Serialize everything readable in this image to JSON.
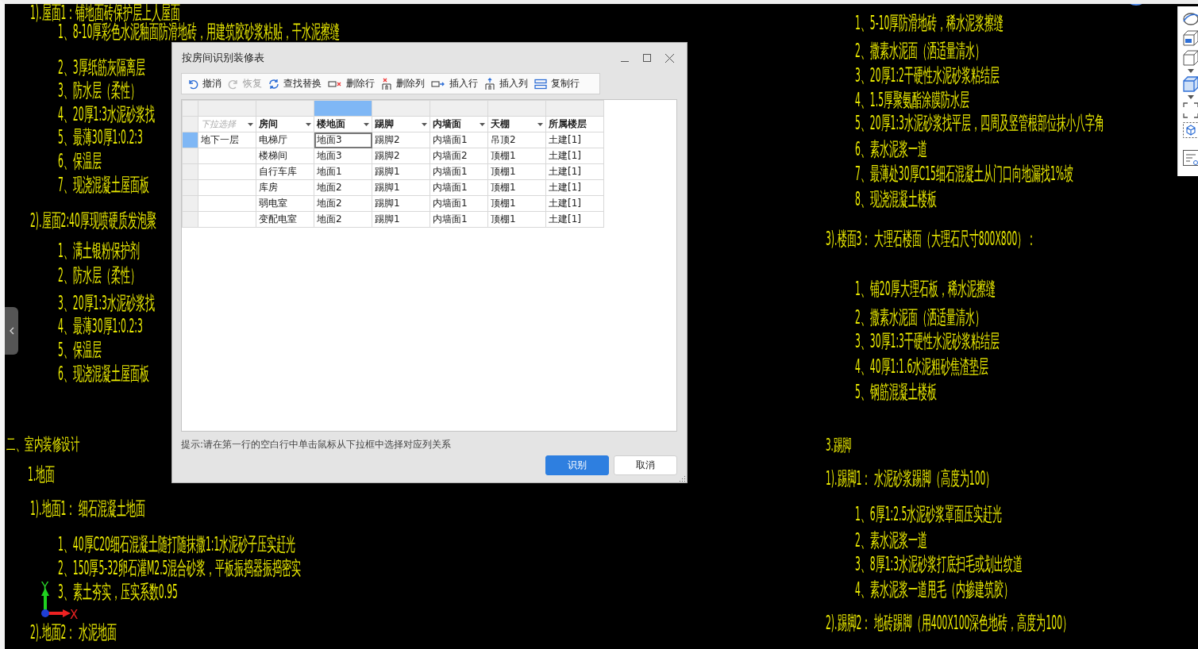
{
  "canvas": {
    "left_lines": [
      {
        "kind": "sub",
        "text": "1).屋面1：铺地面砖保护层上人屋面"
      },
      {
        "kind": "item",
        "text": "1、8-10厚彩色水泥釉面防滑地砖，用建筑胶砂浆粘贴，干水泥擦缝"
      },
      {
        "kind": "item",
        "text": "2、3厚纸筋灰隔离层"
      },
      {
        "kind": "item",
        "text": "3、防水层（柔性）"
      },
      {
        "kind": "item",
        "text": "4、20厚1:3水泥砂浆找"
      },
      {
        "kind": "item",
        "text": "5、最薄30厚1:0.2:3"
      },
      {
        "kind": "item",
        "text": "6、保温层"
      },
      {
        "kind": "item",
        "text": "7、现浇混凝土屋面板"
      },
      {
        "kind": "sub",
        "text": "2).屋面2:40厚现喷硬质发泡聚"
      },
      {
        "kind": "item",
        "text": "1、满土银粉保护剂"
      },
      {
        "kind": "item",
        "text": "2、防水层（柔性）"
      },
      {
        "kind": "item",
        "text": "3、20厚1:3水泥砂浆找"
      },
      {
        "kind": "item",
        "text": "4、最薄30厚1:0.2:3"
      },
      {
        "kind": "item",
        "text": "5、保温层"
      },
      {
        "kind": "item",
        "text": "6、现浇混凝土屋面板"
      },
      {
        "kind": "section",
        "text": "二、室内装修设计"
      },
      {
        "kind": "group",
        "text": "1.地面"
      },
      {
        "kind": "sub",
        "text": "1).地面1：  细石混凝土地面"
      },
      {
        "kind": "item",
        "text": "1、40厚C20细石混凝土随打随抹撒1:1水泥砂子压实赶光"
      },
      {
        "kind": "item",
        "text": "2、150厚5-32卵石灌M2.5混合砂浆，平板振捣器振捣密实"
      },
      {
        "kind": "item",
        "text": "3、素土夯实，压实系数0.95"
      },
      {
        "kind": "sub",
        "text": "2).地面2：  水泥地面"
      }
    ],
    "right_lines": [
      {
        "kind": "item",
        "text": "1、5-10厚防滑地砖，稀水泥浆擦缝"
      },
      {
        "kind": "item",
        "text": "2、撒素水泥面（洒适量清水）"
      },
      {
        "kind": "item",
        "text": "3、20厚1:2干硬性水泥砂浆粘结层"
      },
      {
        "kind": "item",
        "text": "4、1.5厚聚氨酯涂膜防水层"
      },
      {
        "kind": "item",
        "text": "5、20厚1:3水泥砂浆找平层，四周及竖管根部位抹小八字角"
      },
      {
        "kind": "item",
        "text": "6、素水泥浆一道"
      },
      {
        "kind": "item",
        "text": "7、最薄处30厚C15细石混凝土从门口向地漏找1%坡"
      },
      {
        "kind": "item",
        "text": "8、现浇混凝土楼板"
      },
      {
        "kind": "sub",
        "text": "3).楼面3：  大理石楼面（大理石尺寸800X800）："
      },
      {
        "kind": "item",
        "text": "1、铺20厚大理石板，稀水泥擦缝"
      },
      {
        "kind": "item",
        "text": "2、撒素水泥面（洒适量清水）"
      },
      {
        "kind": "item",
        "text": "3、30厚1:3干硬性水泥砂浆粘结层"
      },
      {
        "kind": "item",
        "text": "4、40厚1:1.6水泥粗砂焦渣垫层"
      },
      {
        "kind": "item",
        "text": "5、钢筋混凝土楼板"
      },
      {
        "kind": "section",
        "text": "3.踢脚"
      },
      {
        "kind": "sub",
        "text": "1).踢脚1：  水泥砂浆踢脚（高度为100）"
      },
      {
        "kind": "item",
        "text": "1、6厚1:2.5水泥砂浆罩面压实赶光"
      },
      {
        "kind": "item",
        "text": "2、素水泥浆一道"
      },
      {
        "kind": "item",
        "text": "3、8厚1:3水泥砂浆打底扫毛或划出纹道"
      },
      {
        "kind": "item",
        "text": "4、素水泥浆一道甩毛（内掺建筑胶）"
      },
      {
        "kind": "sub",
        "text": "2).踢脚2：  地砖踢脚（用400X100深色地砖，高度为100）"
      }
    ],
    "ucs": {
      "y_label": "Y",
      "x_label": "X"
    }
  },
  "dialog": {
    "title": "按房间识别装修表",
    "toolbar": [
      {
        "label": "撤消",
        "disabled": false
      },
      {
        "label": "恢复",
        "disabled": true
      },
      {
        "label": "查找替换",
        "disabled": false
      },
      {
        "label": "删除行",
        "disabled": false
      },
      {
        "label": "删除列",
        "disabled": false
      },
      {
        "label": "插入行",
        "disabled": false
      },
      {
        "label": "插入列",
        "disabled": false
      },
      {
        "label": "复制行",
        "disabled": false
      }
    ],
    "columns": [
      {
        "placeholder": "下拉选择",
        "dropdown": true,
        "selected": false
      },
      {
        "label": "房间",
        "dropdown": true,
        "selected": false
      },
      {
        "label": "楼地面",
        "dropdown": true,
        "selected": true
      },
      {
        "label": "踢脚",
        "dropdown": true,
        "selected": false
      },
      {
        "label": "内墙面",
        "dropdown": true,
        "selected": false
      },
      {
        "label": "天棚",
        "dropdown": true,
        "selected": false
      },
      {
        "label": "所属楼层",
        "dropdown": false,
        "selected": false
      }
    ],
    "rows": [
      {
        "selected": true,
        "cells": [
          "地下一层",
          "电梯厅",
          "地面3",
          "踢脚2",
          "内墙面1",
          "吊顶2",
          "土建[1]"
        ]
      },
      {
        "selected": false,
        "cells": [
          null,
          "楼梯间",
          "地面3",
          "踢脚2",
          "内墙面2",
          "顶棚1",
          "土建[1]"
        ]
      },
      {
        "selected": false,
        "cells": [
          null,
          "自行车库",
          "地面1",
          "踢脚1",
          "内墙面1",
          "顶棚1",
          "土建[1]"
        ]
      },
      {
        "selected": false,
        "cells": [
          null,
          "库房",
          "地面2",
          "踢脚1",
          "内墙面1",
          "顶棚1",
          "土建[1]"
        ]
      },
      {
        "selected": false,
        "cells": [
          null,
          "弱电室",
          "地面2",
          "踢脚1",
          "内墙面1",
          "顶棚1",
          "土建[1]"
        ]
      },
      {
        "selected": false,
        "cells": [
          null,
          "变配电室",
          "地面2",
          "踢脚1",
          "内墙面1",
          "顶棚1",
          "土建[1]"
        ]
      }
    ],
    "hint": "提示:请在第一行的空白行中单击鼠标从下拉框中选择对应列关系",
    "buttons": [
      {
        "label": "识别",
        "kind": "primary"
      },
      {
        "label": "取消",
        "kind": "secondary"
      }
    ]
  }
}
